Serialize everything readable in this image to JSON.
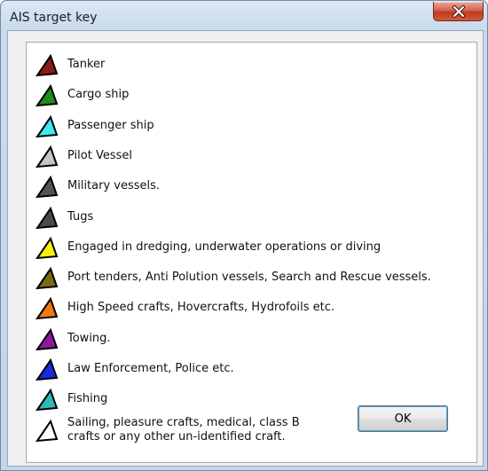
{
  "window": {
    "title": "AIS target key",
    "close_glyph": "X"
  },
  "key_items": [
    {
      "label": "Tanker",
      "color": "#8b1a1a",
      "icon": "tanker-triangle-icon"
    },
    {
      "label": "Cargo ship",
      "color": "#1f8c1f",
      "icon": "cargo-triangle-icon"
    },
    {
      "label": "Passenger ship",
      "color": "#40e8f0",
      "icon": "passenger-triangle-icon"
    },
    {
      "label": "Pilot Vessel",
      "color": "#c6c6c6",
      "icon": "pilot-triangle-icon"
    },
    {
      "label": "Military vessels.",
      "color": "#555555",
      "icon": "military-triangle-icon"
    },
    {
      "label": "Tugs",
      "color": "#4a4a4a",
      "icon": "tug-triangle-icon"
    },
    {
      "label": "Engaged in dredging, underwater operations or diving",
      "color": "#f5f010",
      "icon": "dredging-triangle-icon"
    },
    {
      "label": "Port tenders, Anti Polution vessels, Search and Rescue vessels.",
      "color": "#7a6a10",
      "icon": "port-tender-triangle-icon"
    },
    {
      "label": "High Speed crafts, Hovercrafts, Hydrofoils etc.",
      "color": "#f07a10",
      "icon": "high-speed-triangle-icon"
    },
    {
      "label": "Towing.",
      "color": "#8a1a9a",
      "icon": "towing-triangle-icon"
    },
    {
      "label": "Law Enforcement, Police etc.",
      "color": "#1a2ae0",
      "icon": "law-enforcement-triangle-icon"
    },
    {
      "label": "Fishing",
      "color": "#30b8b8",
      "icon": "fishing-triangle-icon"
    },
    {
      "label": "Sailing, pleasure crafts, medical, class B\ncrafts or any other un-identified craft.",
      "color": "#ffffff",
      "icon": "sailing-triangle-icon"
    }
  ],
  "ok_button": {
    "label": "OK"
  }
}
